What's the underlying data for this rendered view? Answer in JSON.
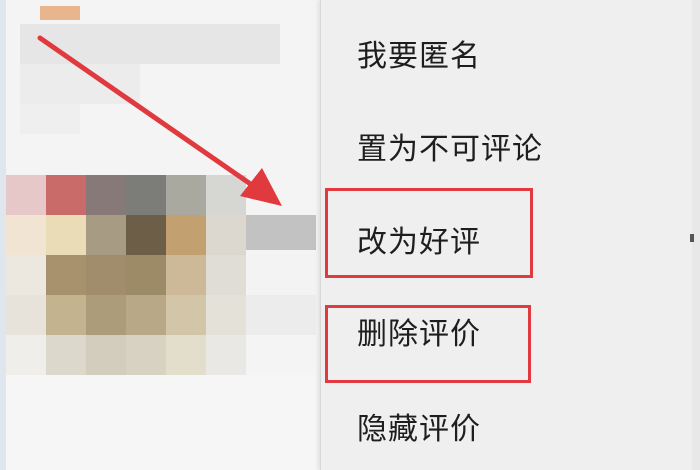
{
  "menu": {
    "items": [
      {
        "label": "我要匿名",
        "highlighted": false
      },
      {
        "label": "置为不可评论",
        "highlighted": false
      },
      {
        "label": "改为好评",
        "highlighted": true
      },
      {
        "label": "删除评价",
        "highlighted": true
      },
      {
        "label": "隐藏评价",
        "highlighted": false
      }
    ]
  },
  "colors": {
    "annotation_red": "#e0393e",
    "menu_background": "#efefef"
  },
  "annotations": {
    "arrow_icon": "red-arrow-icon"
  }
}
